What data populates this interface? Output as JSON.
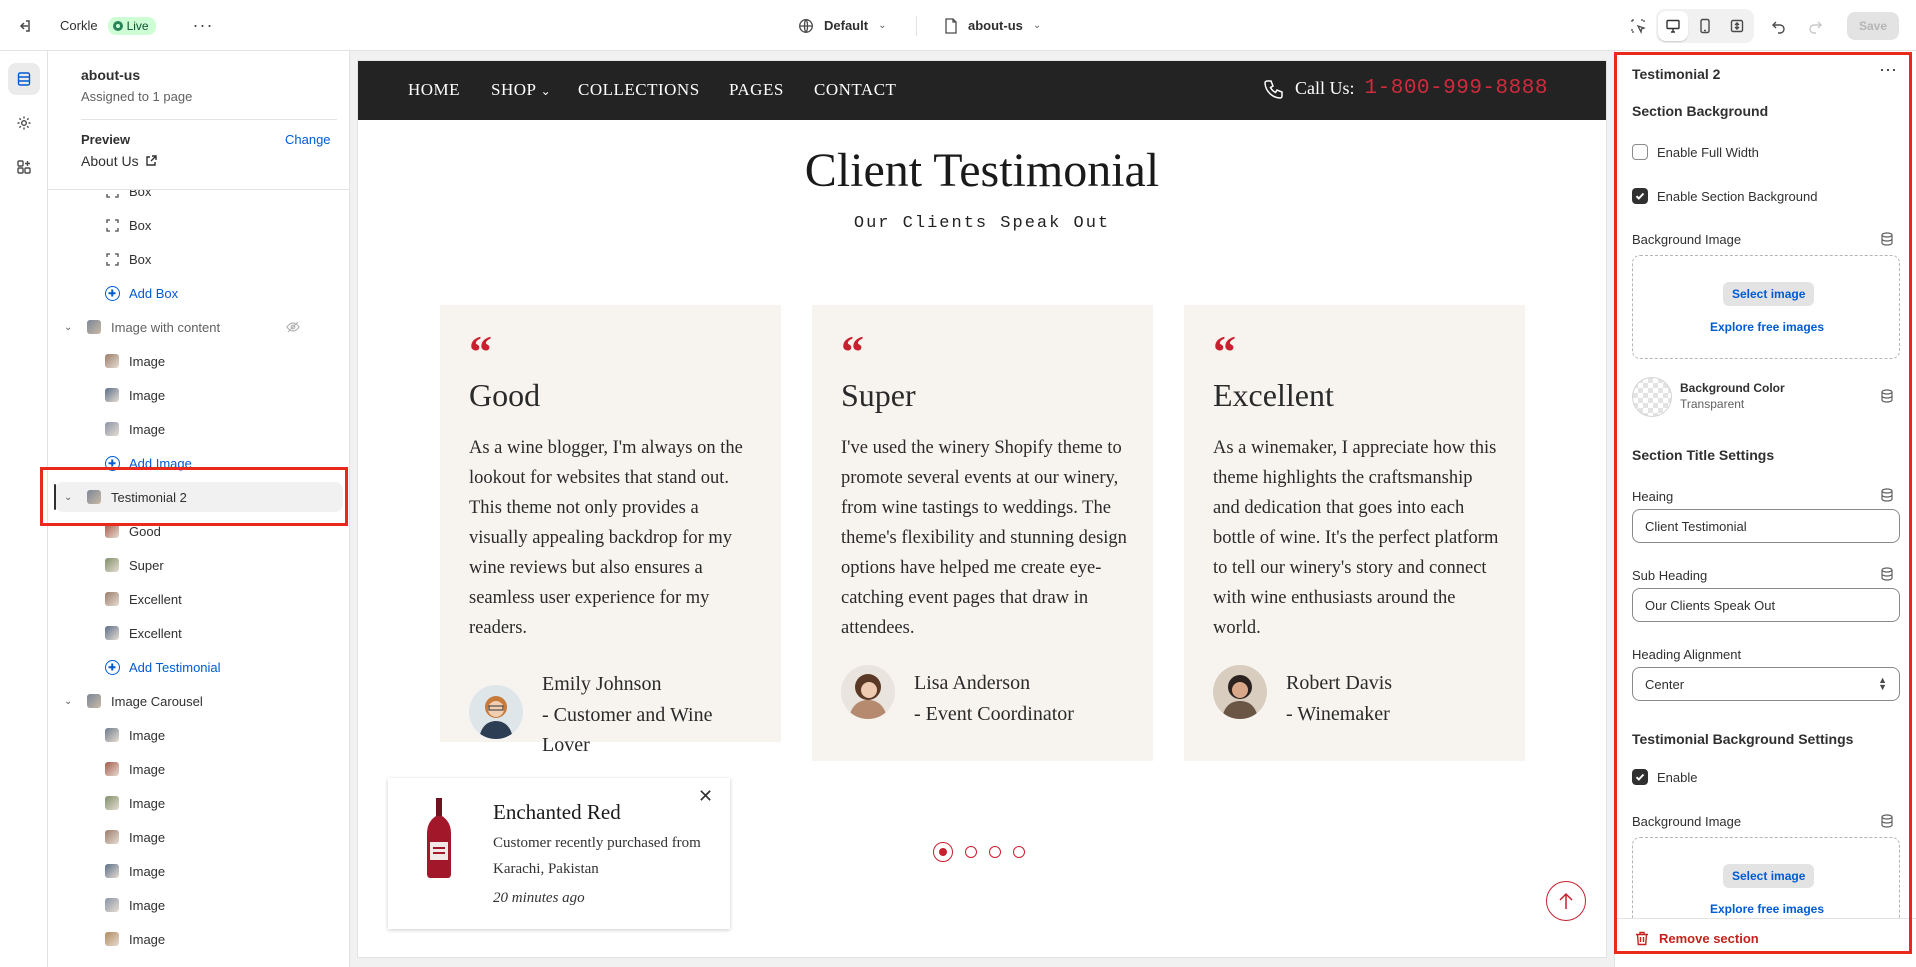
{
  "topbar": {
    "store_name": "Corkle",
    "status_badge": "Live",
    "market_selector": "Default",
    "template_selector": "about-us",
    "save_label": "Save"
  },
  "left_panel": {
    "template_title": "about-us",
    "assigned_text": "Assigned to 1 page",
    "preview_label": "Preview",
    "change_link": "Change",
    "preview_page": "About Us",
    "tree": [
      {
        "label": "Box",
        "kind": "block",
        "icon": "box-icon"
      },
      {
        "label": "Box",
        "kind": "block",
        "icon": "box-icon"
      },
      {
        "label": "Box",
        "kind": "block",
        "icon": "box-icon"
      },
      {
        "label": "Add Box",
        "kind": "add"
      },
      {
        "label": "Image with content",
        "kind": "section",
        "icon": "image-thumb"
      },
      {
        "label": "Image",
        "kind": "block",
        "icon": "image-thumb"
      },
      {
        "label": "Image",
        "kind": "block",
        "icon": "image-thumb"
      },
      {
        "label": "Image",
        "kind": "block",
        "icon": "image-thumb"
      },
      {
        "label": "Add Image",
        "kind": "add"
      },
      {
        "label": "Testimonial 2",
        "kind": "section",
        "selected": true
      },
      {
        "label": "Good",
        "kind": "block"
      },
      {
        "label": "Super",
        "kind": "block"
      },
      {
        "label": "Excellent",
        "kind": "block"
      },
      {
        "label": "Excellent",
        "kind": "block"
      },
      {
        "label": "Add Testimonial",
        "kind": "add"
      },
      {
        "label": "Image Carousel",
        "kind": "section"
      },
      {
        "label": "Image",
        "kind": "block"
      },
      {
        "label": "Image",
        "kind": "block"
      },
      {
        "label": "Image",
        "kind": "block"
      },
      {
        "label": "Image",
        "kind": "block"
      },
      {
        "label": "Image",
        "kind": "block"
      },
      {
        "label": "Image",
        "kind": "block"
      },
      {
        "label": "Image",
        "kind": "block"
      }
    ]
  },
  "store": {
    "nav": [
      "HOME",
      "SHOP",
      "COLLECTIONS",
      "PAGES",
      "CONTACT"
    ],
    "phone_label": "Call Us:",
    "phone_number": "1-800-999-8888",
    "heading": "Client Testimonial",
    "subheading": "Our Clients Speak Out",
    "quote_mark": "“",
    "testimonials": [
      {
        "title": "Good",
        "text": "As a wine blogger, I'm always on the lookout for websites that stand out. This theme not only provides a visually appealing backdrop for my wine reviews but also ensures a seamless user experience for my readers.",
        "name": "Emily Johnson",
        "role": "- Customer and Wine Lover"
      },
      {
        "title": "Super",
        "text": "I've used the winery Shopify theme to promote several events at our winery, from wine tastings to weddings. The theme's flexibility and stunning design options have helped me create eye-catching event pages that draw in attendees.",
        "name": "Lisa Anderson",
        "role": "- Event Coordinator"
      },
      {
        "title": "Excellent",
        "text": "As a winemaker, I appreciate how this theme highlights the craftsmanship and dedication that goes into each bottle of wine. It's the perfect platform to tell our winery's story and connect with wine enthusiasts around the world.",
        "name": "Robert Davis",
        "role": "- Winemaker"
      }
    ],
    "popup": {
      "product": "Enchanted Red",
      "text": "Customer recently purchased from Karachi, Pakistan",
      "time": "20 minutes ago"
    },
    "carousel": {
      "pages": 4,
      "active": 1
    }
  },
  "right_panel": {
    "section_title": "Testimonial 2",
    "section_background_heading": "Section Background",
    "enable_full_width": "Enable Full Width",
    "enable_full_width_checked": false,
    "enable_section_background": "Enable Section Background",
    "enable_section_background_checked": true,
    "background_image_label": "Background Image",
    "select_image": "Select image",
    "explore_free": "Explore free images",
    "background_color_label": "Background Color",
    "background_color_value": "Transparent",
    "title_settings_heading": "Section Title Settings",
    "heading_label": "Heaing",
    "heading_value": "Client Testimonial",
    "subheading_label": "Sub Heading",
    "subheading_value": "Our Clients Speak Out",
    "alignment_label": "Heading Alignment",
    "alignment_value": "Center",
    "testimonial_bg_heading": "Testimonial Background Settings",
    "enable_label": "Enable",
    "enable_checked": true,
    "background_image_label_2": "Background Image",
    "select_image_2": "Select image",
    "explore_free_2": "Explore free images",
    "remove_section": "Remove section"
  },
  "colors": {
    "accent_red": "#c8202f",
    "link_blue": "#005bd3",
    "nav_bg": "#232323",
    "card_bg": "#f7f4f0",
    "highlight_box": "#e8291c"
  }
}
